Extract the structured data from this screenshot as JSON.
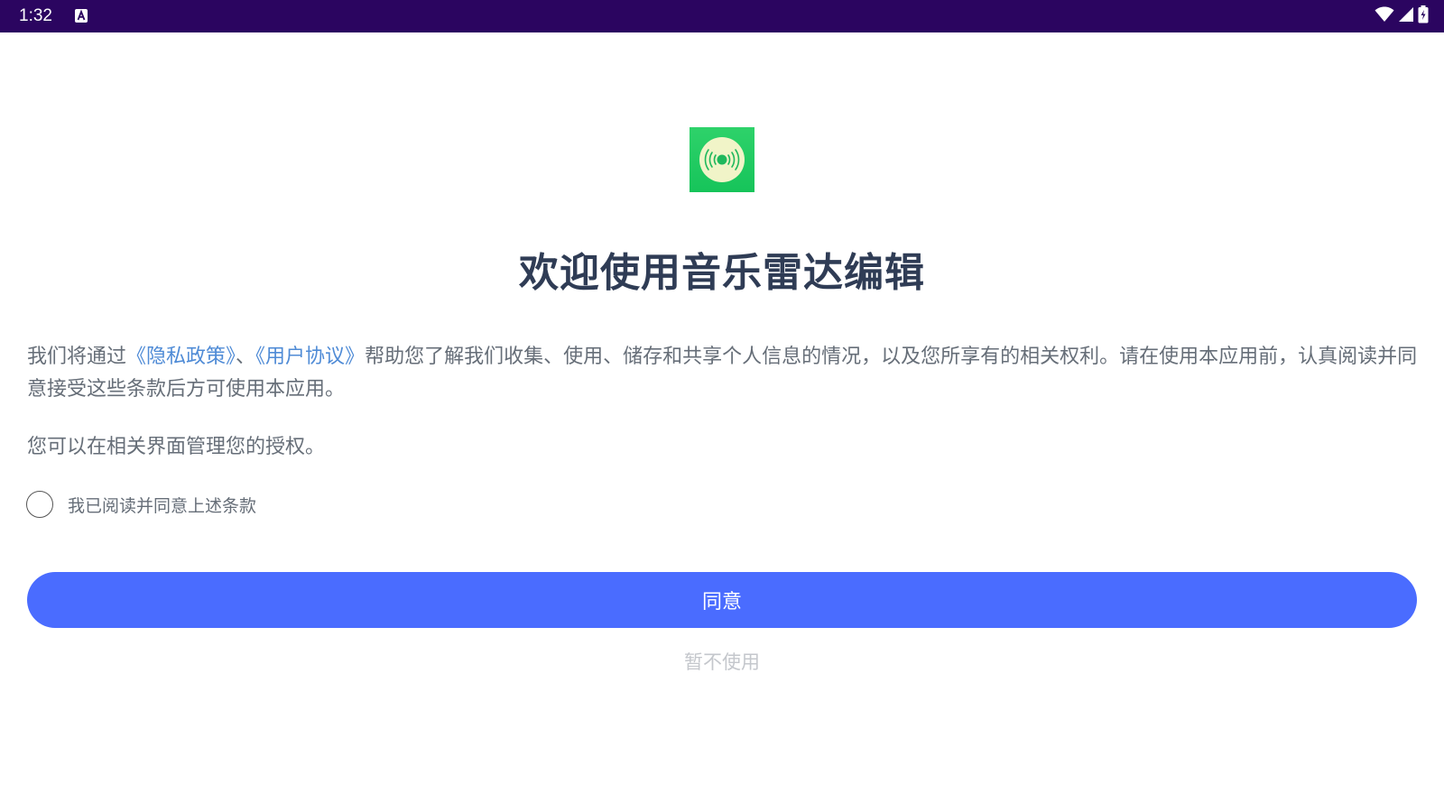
{
  "status_bar": {
    "time": "1:32",
    "notification_icon": "text-a-box-icon",
    "wifi_icon": "wifi-icon",
    "signal_icon": "cellular-signal-icon",
    "battery_icon": "battery-charging-icon",
    "background": "#2b0560"
  },
  "app": {
    "icon": "music-radar-icon",
    "title": "欢迎使用音乐雷达编辑"
  },
  "notice": {
    "prefix": "我们将通过",
    "privacy_link": "《隐私政策》",
    "separator": "、",
    "terms_link": "《用户协议》",
    "suffix": "帮助您了解我们收集、使用、储存和共享个人信息的情况，以及您所享有的相关权利。请在使用本应用前，认真阅读并同意接受这些条款后方可使用本应用。",
    "manage": "您可以在相关界面管理您的授权。"
  },
  "consent": {
    "checkbox_label": "我已阅读并同意上述条款",
    "checked": false
  },
  "actions": {
    "agree_label": "同意",
    "decline_label": "暂不使用"
  },
  "colors": {
    "primary_button": "#4a6cff",
    "link": "#4f8bd6",
    "title": "#2f3c55"
  }
}
